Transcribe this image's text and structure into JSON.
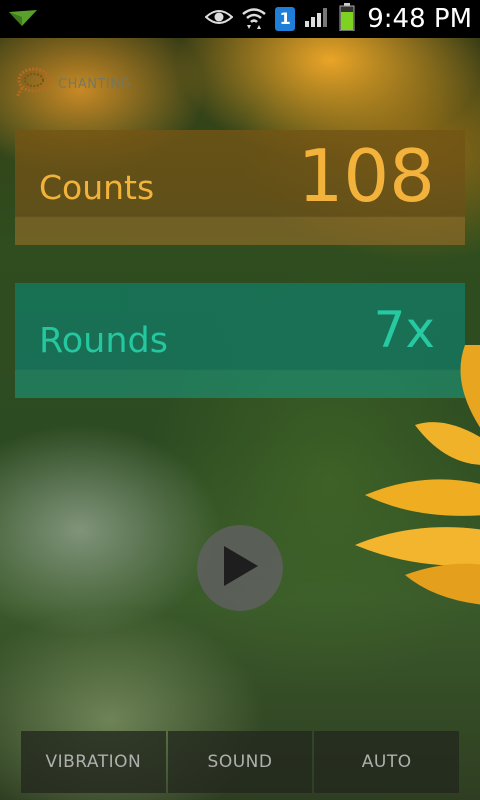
{
  "status_bar": {
    "time": "9:48 PM",
    "sim_slot": "1",
    "icons": [
      "app-notification-icon",
      "eye-icon",
      "wifi-icon",
      "sim-icon",
      "signal-icon",
      "battery-icon"
    ]
  },
  "app": {
    "title": "CHANTING",
    "logo_icon": "mala-beads-icon"
  },
  "counts": {
    "label": "Counts",
    "value": "108"
  },
  "rounds": {
    "label": "Rounds",
    "value": "7x"
  },
  "controls": {
    "play_icon": "play-icon"
  },
  "bottom_bar": {
    "buttons": [
      "VIBRATION",
      "SOUND",
      "AUTO"
    ]
  },
  "colors": {
    "counts_accent": "#f3b23b",
    "rounds_accent": "#26c9a2"
  }
}
